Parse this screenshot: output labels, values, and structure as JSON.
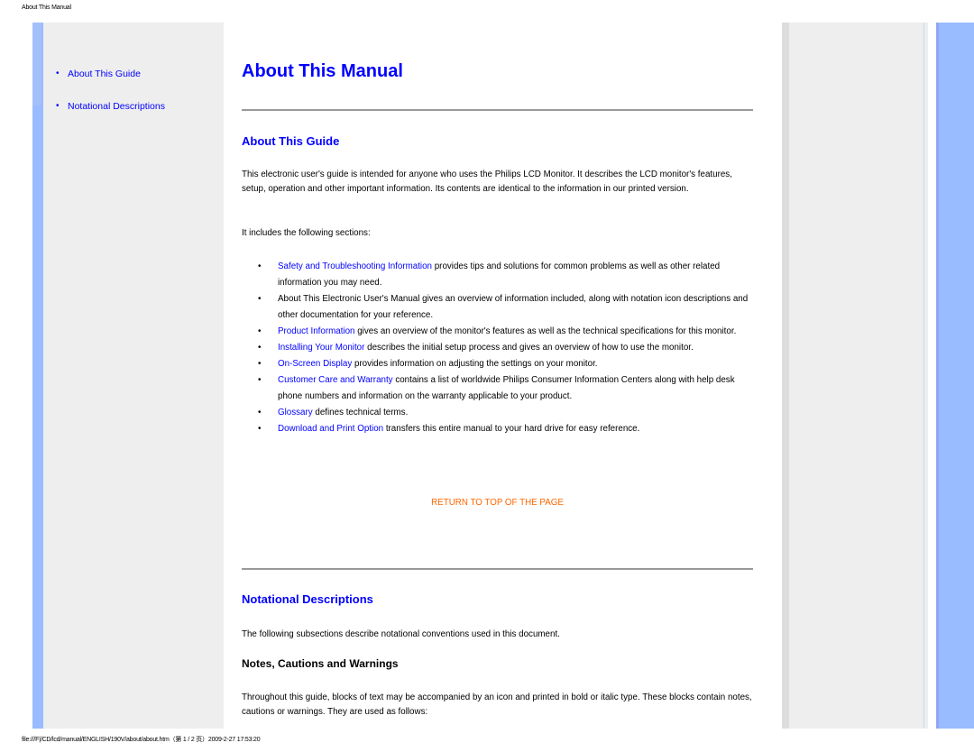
{
  "page_header": "About This Manual",
  "sidebar": {
    "items": [
      {
        "label": "About This Guide"
      },
      {
        "label": "Notational Descriptions"
      }
    ],
    "bullet": "•"
  },
  "main": {
    "title": "About This Manual",
    "guide": {
      "heading": "About This Guide",
      "intro": "This electronic user's guide is intended for anyone who uses the Philips LCD Monitor. It describes the LCD monitor's features, setup, operation and other important information. Its contents are identical to the information in our printed version.",
      "includes": "It includes the following sections:",
      "bullet": "•",
      "sections": [
        {
          "link": "Safety and Troubleshooting Information",
          "text": " provides tips and solutions for common problems as well as other related information you may need."
        },
        {
          "link": "",
          "text": "About This Electronic User's Manual gives an overview of information included, along with notation icon descriptions and other documentation for your reference."
        },
        {
          "link": "Product Information",
          "text": " gives an overview of the monitor's features as well as the technical specifications for this monitor."
        },
        {
          "link": "Installing Your Monitor",
          "text": " describes the initial setup process and gives an overview of how to use the monitor."
        },
        {
          "link": "On-Screen Display",
          "text": " provides information on adjusting the settings on your monitor."
        },
        {
          "link": "Customer Care and Warranty",
          "text": " contains a list of worldwide Philips Consumer Information Centers along with help desk phone numbers and information on the warranty applicable to your product."
        },
        {
          "link": "Glossary",
          "text": " defines technical terms."
        },
        {
          "link": "Download and Print Option",
          "text": " transfers this entire manual to your hard drive for easy reference."
        }
      ],
      "return_link": "RETURN TO TOP OF THE PAGE"
    },
    "notational": {
      "heading": "Notational Descriptions",
      "intro": "The following subsections describe notational conventions used in this document.",
      "subheading": "Notes, Cautions and Warnings",
      "body": "Throughout this guide, blocks of text may be accompanied by an icon and printed in bold or italic type. These blocks contain notes, cautions or warnings. They are used as follows:"
    }
  },
  "page_footer": "file:///F|/CD/lcd/manual/ENGLISH/190V/about/about.htm（第 1 / 2 页）2009-2-27 17:53:20",
  "colors": {
    "link": "#0000ff",
    "return_link": "#ff6600",
    "side_bar": "#99bbff",
    "panel": "#eeeeee"
  }
}
